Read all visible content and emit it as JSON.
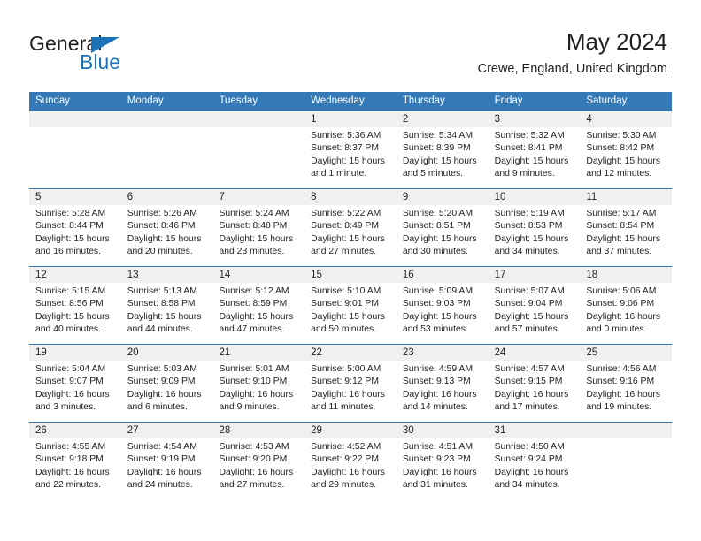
{
  "brand": {
    "name_part1": "General",
    "name_part2": "Blue",
    "accent_color": "#1b72b8"
  },
  "header": {
    "title": "May 2024",
    "subtitle": "Crewe, England, United Kingdom"
  },
  "calendar": {
    "header_color": "#357ab8",
    "weekdays": [
      "Sunday",
      "Monday",
      "Tuesday",
      "Wednesday",
      "Thursday",
      "Friday",
      "Saturday"
    ],
    "weeks": [
      [
        {
          "day": "",
          "sunrise": "",
          "sunset": "",
          "daylight1": "",
          "daylight2": ""
        },
        {
          "day": "",
          "sunrise": "",
          "sunset": "",
          "daylight1": "",
          "daylight2": ""
        },
        {
          "day": "",
          "sunrise": "",
          "sunset": "",
          "daylight1": "",
          "daylight2": ""
        },
        {
          "day": "1",
          "sunrise": "Sunrise: 5:36 AM",
          "sunset": "Sunset: 8:37 PM",
          "daylight1": "Daylight: 15 hours",
          "daylight2": "and 1 minute."
        },
        {
          "day": "2",
          "sunrise": "Sunrise: 5:34 AM",
          "sunset": "Sunset: 8:39 PM",
          "daylight1": "Daylight: 15 hours",
          "daylight2": "and 5 minutes."
        },
        {
          "day": "3",
          "sunrise": "Sunrise: 5:32 AM",
          "sunset": "Sunset: 8:41 PM",
          "daylight1": "Daylight: 15 hours",
          "daylight2": "and 9 minutes."
        },
        {
          "day": "4",
          "sunrise": "Sunrise: 5:30 AM",
          "sunset": "Sunset: 8:42 PM",
          "daylight1": "Daylight: 15 hours",
          "daylight2": "and 12 minutes."
        }
      ],
      [
        {
          "day": "5",
          "sunrise": "Sunrise: 5:28 AM",
          "sunset": "Sunset: 8:44 PM",
          "daylight1": "Daylight: 15 hours",
          "daylight2": "and 16 minutes."
        },
        {
          "day": "6",
          "sunrise": "Sunrise: 5:26 AM",
          "sunset": "Sunset: 8:46 PM",
          "daylight1": "Daylight: 15 hours",
          "daylight2": "and 20 minutes."
        },
        {
          "day": "7",
          "sunrise": "Sunrise: 5:24 AM",
          "sunset": "Sunset: 8:48 PM",
          "daylight1": "Daylight: 15 hours",
          "daylight2": "and 23 minutes."
        },
        {
          "day": "8",
          "sunrise": "Sunrise: 5:22 AM",
          "sunset": "Sunset: 8:49 PM",
          "daylight1": "Daylight: 15 hours",
          "daylight2": "and 27 minutes."
        },
        {
          "day": "9",
          "sunrise": "Sunrise: 5:20 AM",
          "sunset": "Sunset: 8:51 PM",
          "daylight1": "Daylight: 15 hours",
          "daylight2": "and 30 minutes."
        },
        {
          "day": "10",
          "sunrise": "Sunrise: 5:19 AM",
          "sunset": "Sunset: 8:53 PM",
          "daylight1": "Daylight: 15 hours",
          "daylight2": "and 34 minutes."
        },
        {
          "day": "11",
          "sunrise": "Sunrise: 5:17 AM",
          "sunset": "Sunset: 8:54 PM",
          "daylight1": "Daylight: 15 hours",
          "daylight2": "and 37 minutes."
        }
      ],
      [
        {
          "day": "12",
          "sunrise": "Sunrise: 5:15 AM",
          "sunset": "Sunset: 8:56 PM",
          "daylight1": "Daylight: 15 hours",
          "daylight2": "and 40 minutes."
        },
        {
          "day": "13",
          "sunrise": "Sunrise: 5:13 AM",
          "sunset": "Sunset: 8:58 PM",
          "daylight1": "Daylight: 15 hours",
          "daylight2": "and 44 minutes."
        },
        {
          "day": "14",
          "sunrise": "Sunrise: 5:12 AM",
          "sunset": "Sunset: 8:59 PM",
          "daylight1": "Daylight: 15 hours",
          "daylight2": "and 47 minutes."
        },
        {
          "day": "15",
          "sunrise": "Sunrise: 5:10 AM",
          "sunset": "Sunset: 9:01 PM",
          "daylight1": "Daylight: 15 hours",
          "daylight2": "and 50 minutes."
        },
        {
          "day": "16",
          "sunrise": "Sunrise: 5:09 AM",
          "sunset": "Sunset: 9:03 PM",
          "daylight1": "Daylight: 15 hours",
          "daylight2": "and 53 minutes."
        },
        {
          "day": "17",
          "sunrise": "Sunrise: 5:07 AM",
          "sunset": "Sunset: 9:04 PM",
          "daylight1": "Daylight: 15 hours",
          "daylight2": "and 57 minutes."
        },
        {
          "day": "18",
          "sunrise": "Sunrise: 5:06 AM",
          "sunset": "Sunset: 9:06 PM",
          "daylight1": "Daylight: 16 hours",
          "daylight2": "and 0 minutes."
        }
      ],
      [
        {
          "day": "19",
          "sunrise": "Sunrise: 5:04 AM",
          "sunset": "Sunset: 9:07 PM",
          "daylight1": "Daylight: 16 hours",
          "daylight2": "and 3 minutes."
        },
        {
          "day": "20",
          "sunrise": "Sunrise: 5:03 AM",
          "sunset": "Sunset: 9:09 PM",
          "daylight1": "Daylight: 16 hours",
          "daylight2": "and 6 minutes."
        },
        {
          "day": "21",
          "sunrise": "Sunrise: 5:01 AM",
          "sunset": "Sunset: 9:10 PM",
          "daylight1": "Daylight: 16 hours",
          "daylight2": "and 9 minutes."
        },
        {
          "day": "22",
          "sunrise": "Sunrise: 5:00 AM",
          "sunset": "Sunset: 9:12 PM",
          "daylight1": "Daylight: 16 hours",
          "daylight2": "and 11 minutes."
        },
        {
          "day": "23",
          "sunrise": "Sunrise: 4:59 AM",
          "sunset": "Sunset: 9:13 PM",
          "daylight1": "Daylight: 16 hours",
          "daylight2": "and 14 minutes."
        },
        {
          "day": "24",
          "sunrise": "Sunrise: 4:57 AM",
          "sunset": "Sunset: 9:15 PM",
          "daylight1": "Daylight: 16 hours",
          "daylight2": "and 17 minutes."
        },
        {
          "day": "25",
          "sunrise": "Sunrise: 4:56 AM",
          "sunset": "Sunset: 9:16 PM",
          "daylight1": "Daylight: 16 hours",
          "daylight2": "and 19 minutes."
        }
      ],
      [
        {
          "day": "26",
          "sunrise": "Sunrise: 4:55 AM",
          "sunset": "Sunset: 9:18 PM",
          "daylight1": "Daylight: 16 hours",
          "daylight2": "and 22 minutes."
        },
        {
          "day": "27",
          "sunrise": "Sunrise: 4:54 AM",
          "sunset": "Sunset: 9:19 PM",
          "daylight1": "Daylight: 16 hours",
          "daylight2": "and 24 minutes."
        },
        {
          "day": "28",
          "sunrise": "Sunrise: 4:53 AM",
          "sunset": "Sunset: 9:20 PM",
          "daylight1": "Daylight: 16 hours",
          "daylight2": "and 27 minutes."
        },
        {
          "day": "29",
          "sunrise": "Sunrise: 4:52 AM",
          "sunset": "Sunset: 9:22 PM",
          "daylight1": "Daylight: 16 hours",
          "daylight2": "and 29 minutes."
        },
        {
          "day": "30",
          "sunrise": "Sunrise: 4:51 AM",
          "sunset": "Sunset: 9:23 PM",
          "daylight1": "Daylight: 16 hours",
          "daylight2": "and 31 minutes."
        },
        {
          "day": "31",
          "sunrise": "Sunrise: 4:50 AM",
          "sunset": "Sunset: 9:24 PM",
          "daylight1": "Daylight: 16 hours",
          "daylight2": "and 34 minutes."
        },
        {
          "day": "",
          "sunrise": "",
          "sunset": "",
          "daylight1": "",
          "daylight2": ""
        }
      ]
    ]
  }
}
